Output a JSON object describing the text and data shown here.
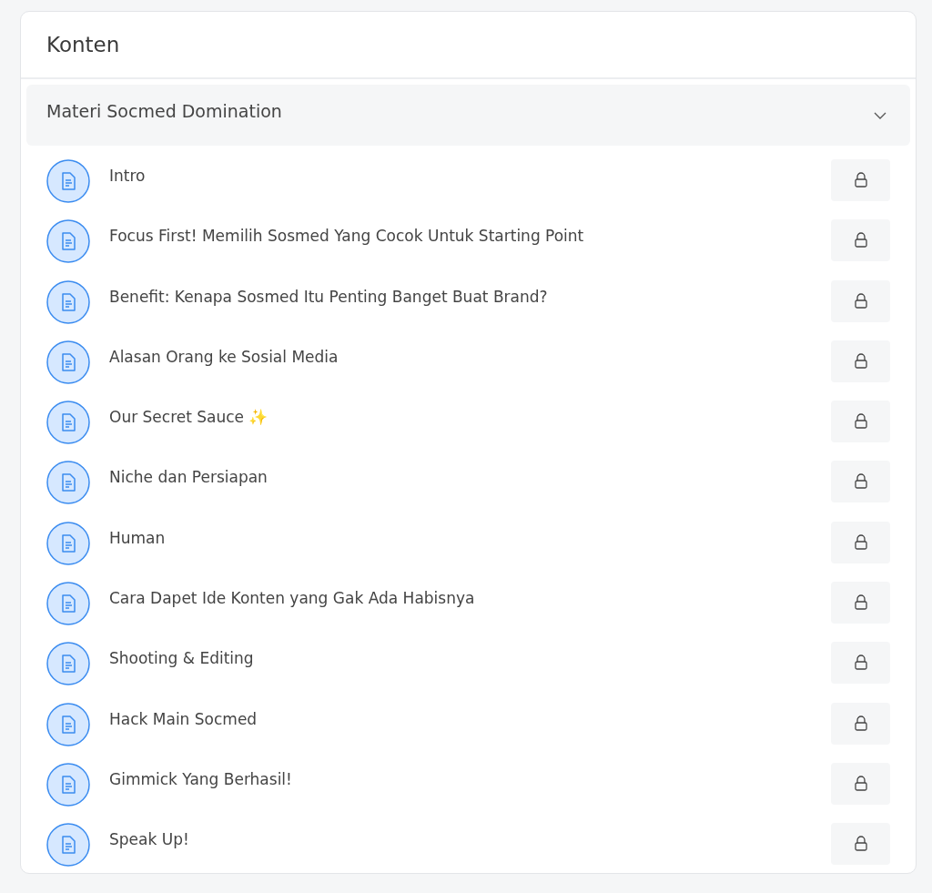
{
  "card": {
    "title": "Konten"
  },
  "section": {
    "title": "Materi Socmed Domination",
    "expanded": true,
    "lessons": [
      {
        "title": "Intro",
        "locked": true
      },
      {
        "title": "Focus First! Memilih Sosmed Yang Cocok Untuk Starting Point",
        "locked": true
      },
      {
        "title": "Benefit: Kenapa Sosmed Itu Penting Banget Buat Brand?",
        "locked": true
      },
      {
        "title": "Alasan Orang ke Sosial Media",
        "locked": true
      },
      {
        "title": "Our Secret Sauce ✨",
        "locked": true
      },
      {
        "title": "Niche dan Persiapan",
        "locked": true
      },
      {
        "title": "Human",
        "locked": true
      },
      {
        "title": "Cara Dapet Ide Konten yang Gak Ada Habisnya",
        "locked": true
      },
      {
        "title": "Shooting & Editing",
        "locked": true
      },
      {
        "title": "Hack Main Socmed",
        "locked": true
      },
      {
        "title": "Gimmick Yang Berhasil!",
        "locked": true
      },
      {
        "title": "Speak Up!",
        "locked": true
      }
    ]
  }
}
